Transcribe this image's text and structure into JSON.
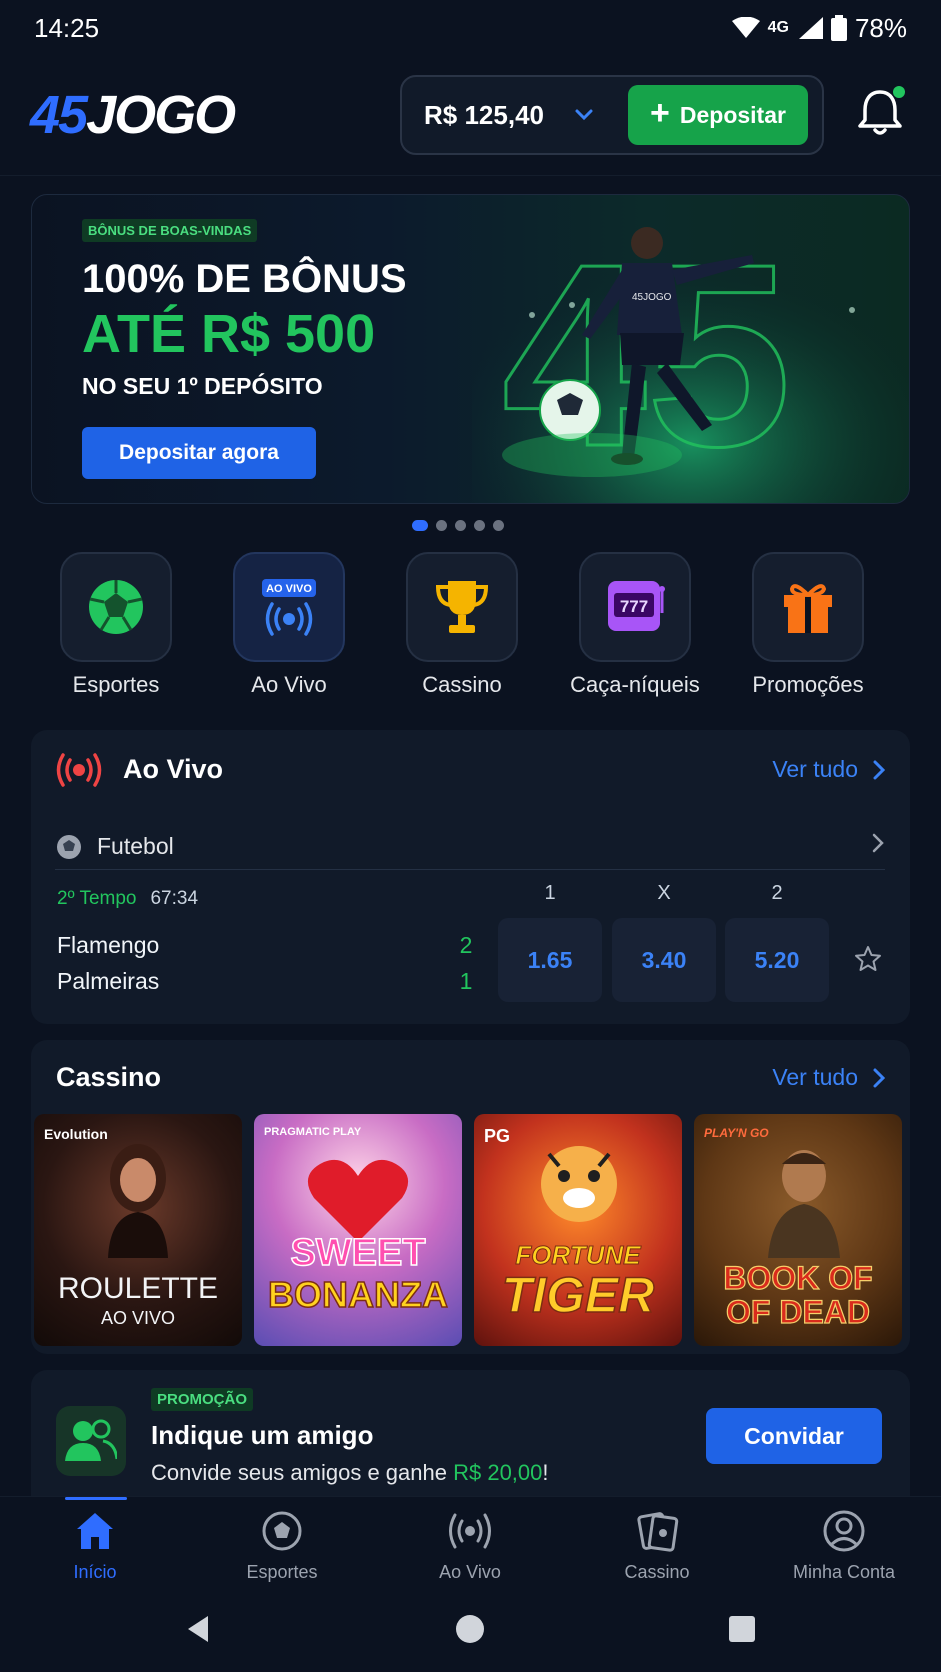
{
  "status": {
    "time": "14:25",
    "network": "4G",
    "battery": "78%"
  },
  "header": {
    "logo_number": "45",
    "logo_text": "JOGO",
    "balance": "R$ 125,40",
    "deposit_label": "Depositar"
  },
  "banner": {
    "tag": "BÔNUS DE BOAS-VINDAS",
    "title": "100% DE BÔNUS",
    "amount": "ATÉ R$ 500",
    "subtitle": "NO SEU 1º DEPÓSITO",
    "cta": "Depositar agora",
    "art_number": "45",
    "jersey_text": "45JOGO",
    "slides_total": 5,
    "slide_active": 1
  },
  "categories": [
    {
      "label": "Esportes",
      "icon": "soccer-ball-icon"
    },
    {
      "label": "Ao Vivo",
      "icon": "live-broadcast-icon",
      "badge": "AO VIVO"
    },
    {
      "label": "Cassino",
      "icon": "trophy-icon"
    },
    {
      "label": "Caça-níqueis",
      "icon": "slot-machine-icon",
      "reels": "777"
    },
    {
      "label": "Promoções",
      "icon": "gift-icon"
    }
  ],
  "live": {
    "title": "Ao Vivo",
    "see_all": "Ver tudo",
    "league": "Futebol",
    "match": {
      "period": "2º Tempo",
      "clock": "67:34",
      "home": "Flamengo",
      "away": "Palmeiras",
      "home_score": "2",
      "away_score": "1",
      "headers": [
        "1",
        "X",
        "2"
      ],
      "odds": [
        "1.65",
        "3.40",
        "5.20"
      ]
    }
  },
  "casino": {
    "title": "Cassino",
    "see_all": "Ver tudo",
    "games": [
      {
        "provider": "Evolution",
        "title": "ROULETTE",
        "subtitle": "AO VIVO"
      },
      {
        "provider": "PRAGMATIC PLAY",
        "title": "SWEET",
        "subtitle": "BONANZA"
      },
      {
        "provider": "PG",
        "title": "FORTUNE",
        "subtitle": "TIGER"
      },
      {
        "provider": "PLAY'N GO",
        "title": "BOOK OF",
        "subtitle": "OF DEAD"
      }
    ]
  },
  "promo": {
    "tag": "PROMOÇÃO",
    "title": "Indique um amigo",
    "text_before": "Convide seus amigos e ganhe ",
    "amount": "R$ 20,00",
    "text_after": "!",
    "cta": "Convidar"
  },
  "bottom_nav": [
    {
      "label": "Início",
      "icon": "home-icon",
      "active": true
    },
    {
      "label": "Esportes",
      "icon": "soccer-ball-icon"
    },
    {
      "label": "Ao Vivo",
      "icon": "live-broadcast-icon"
    },
    {
      "label": "Cassino",
      "icon": "cards-icon"
    },
    {
      "label": "Minha Conta",
      "icon": "user-icon"
    }
  ],
  "colors": {
    "background": "#0b1220",
    "card": "#111a29",
    "accent_blue": "#2f6dff",
    "accent_green": "#22c55e"
  }
}
